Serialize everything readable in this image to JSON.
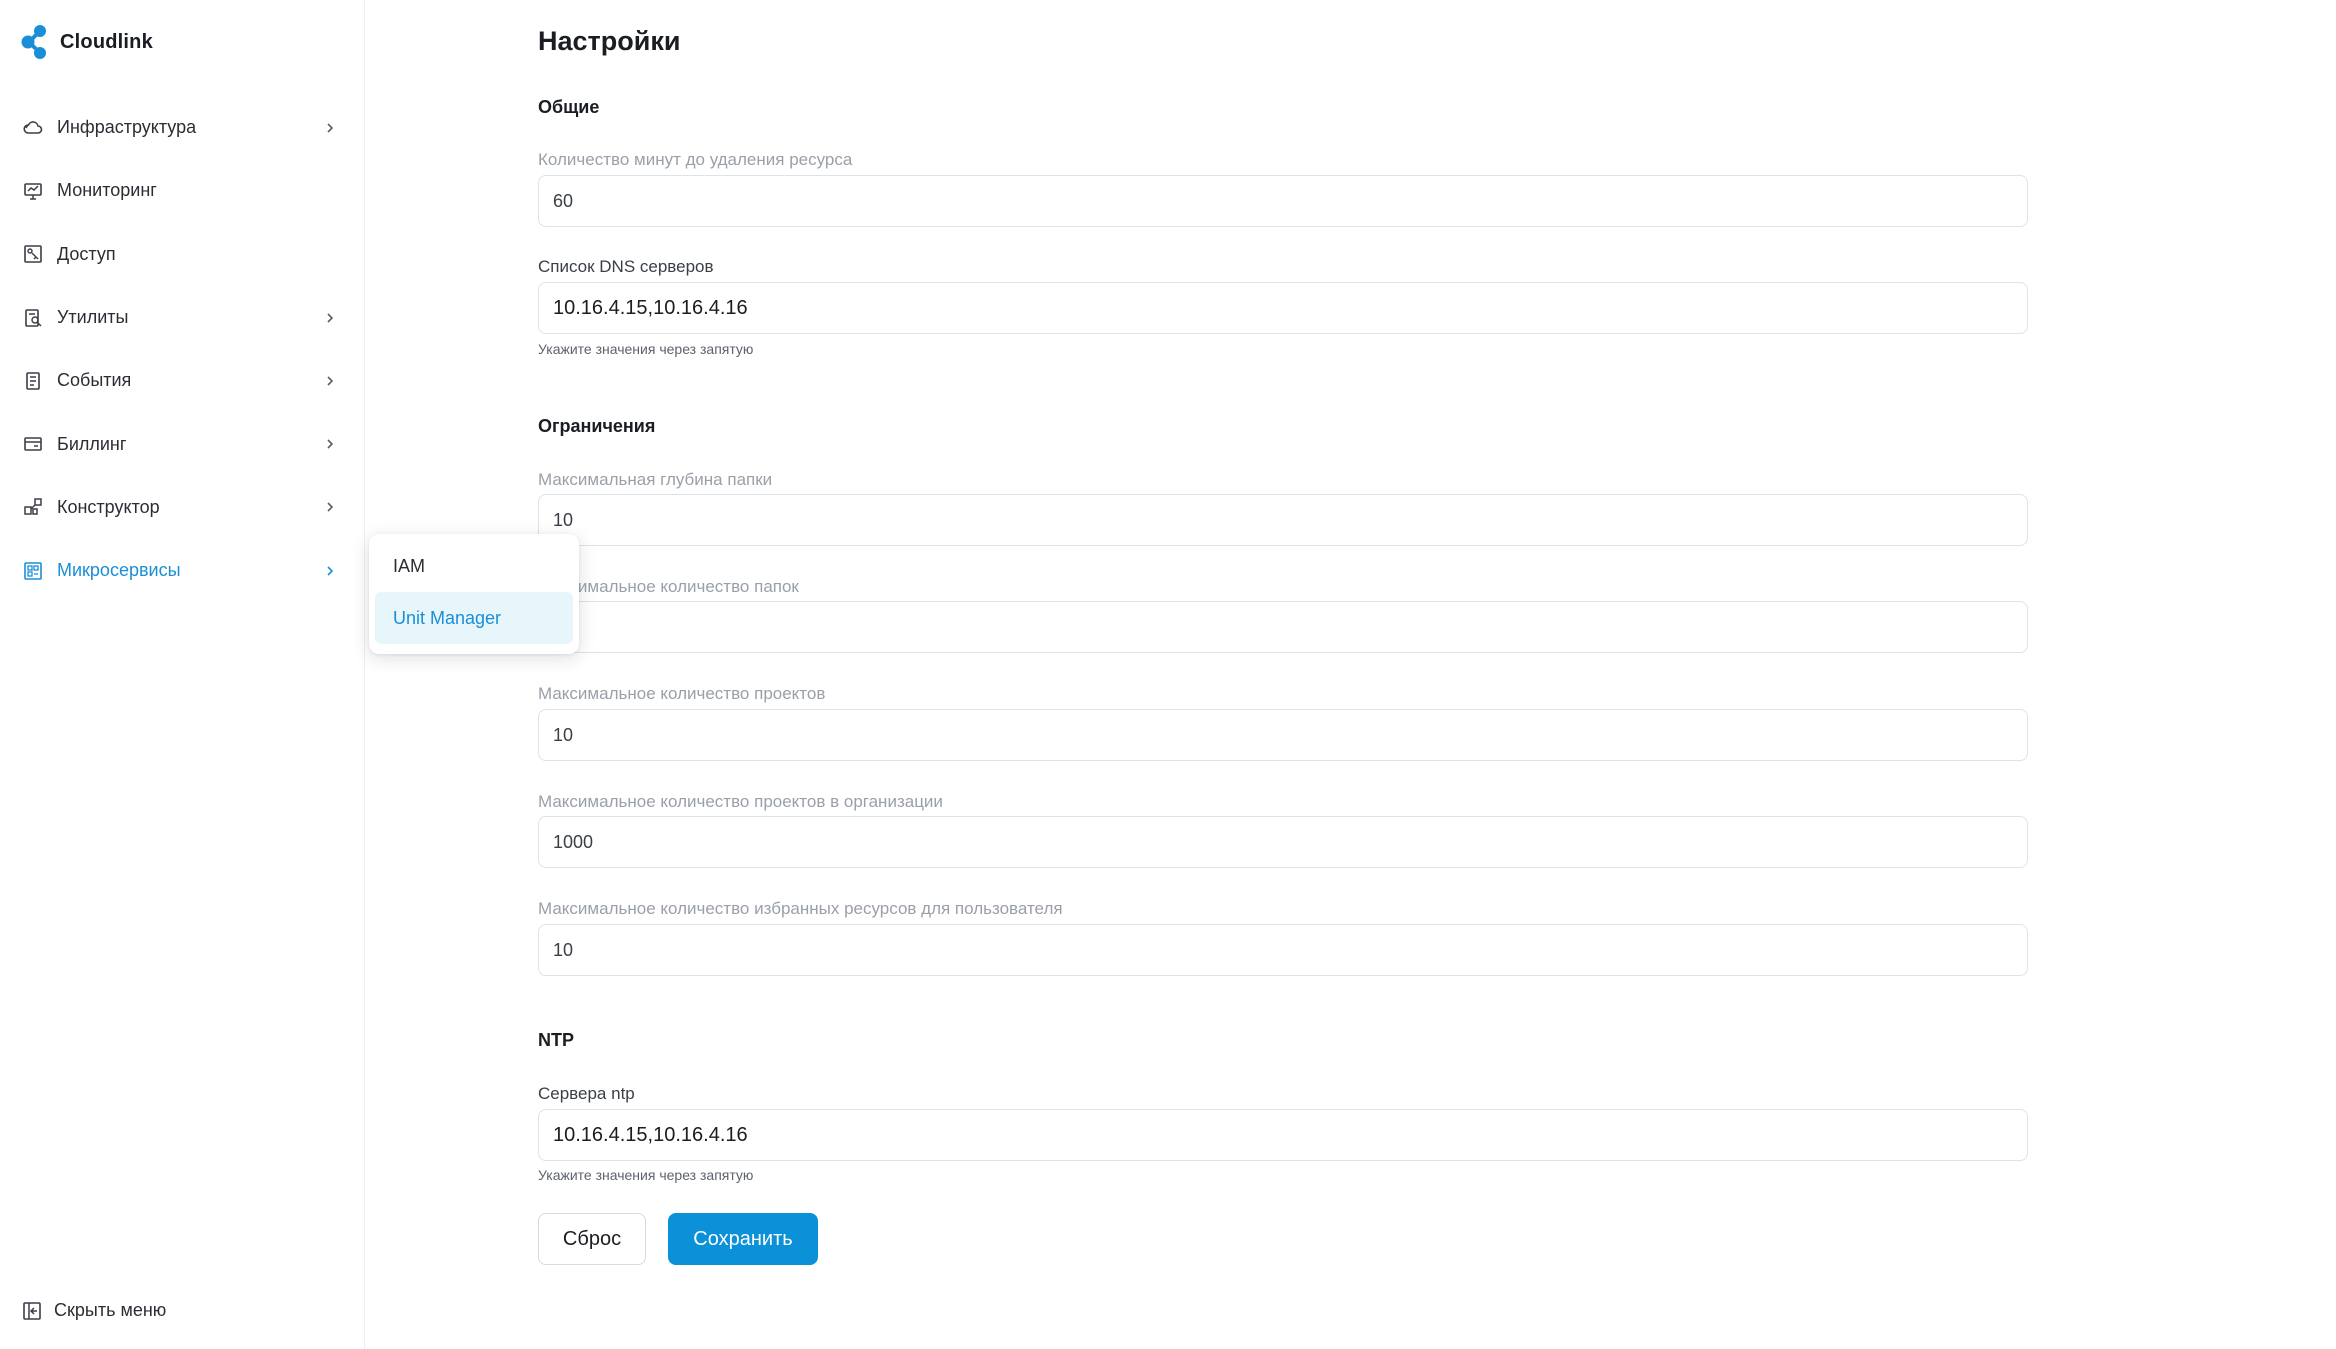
{
  "app": {
    "name": "Cloudlink",
    "brand_color": "#1a8fd6"
  },
  "sidebar": {
    "items": [
      {
        "label": "Инфраструктура",
        "icon": "cloud-icon",
        "has_submenu": true,
        "active": false
      },
      {
        "label": "Мониторинг",
        "icon": "monitor-icon",
        "has_submenu": false,
        "active": false
      },
      {
        "label": "Доступ",
        "icon": "access-icon",
        "has_submenu": false,
        "active": false
      },
      {
        "label": "Утилиты",
        "icon": "utilities-icon",
        "has_submenu": true,
        "active": false
      },
      {
        "label": "События",
        "icon": "events-icon",
        "has_submenu": true,
        "active": false
      },
      {
        "label": "Биллинг",
        "icon": "billing-icon",
        "has_submenu": true,
        "active": false
      },
      {
        "label": "Конструктор",
        "icon": "constructor-icon",
        "has_submenu": true,
        "active": false
      },
      {
        "label": "Микросервисы",
        "icon": "microservices-icon",
        "has_submenu": true,
        "active": true
      }
    ],
    "hide_menu_label": "Скрыть меню"
  },
  "submenu": {
    "items": [
      {
        "label": "IAM",
        "selected": false
      },
      {
        "label": "Unit Manager",
        "selected": true
      }
    ]
  },
  "page": {
    "title": "Настройки",
    "sections": {
      "general": {
        "title": "Общие",
        "minutes_label": "Количество минут до удаления ресурса",
        "minutes_value": "60",
        "dns_label": "Список DNS серверов",
        "dns_value": "10.16.4.15,10.16.4.16",
        "dns_hint": "Укажите значения через запятую"
      },
      "limits": {
        "title": "Ограничения",
        "folder_depth_label": "Максимальная глубина папки",
        "folder_depth_value": "10",
        "folders_label": "Максимальное количество папок",
        "folders_value": "",
        "projects_label": "Максимальное количество проектов",
        "projects_value": "10",
        "org_projects_label": "Максимальное количество проектов в организации",
        "org_projects_value": "1000",
        "favorites_label": "Максимальное количество избранных ресурсов для пользователя",
        "favorites_value": "10"
      },
      "ntp": {
        "title": "NTP",
        "servers_label": "Сервера ntp",
        "servers_value": "10.16.4.15,10.16.4.16",
        "servers_hint": "Укажите значения через запятую"
      }
    },
    "buttons": {
      "reset": "Сброс",
      "save": "Сохранить"
    }
  }
}
